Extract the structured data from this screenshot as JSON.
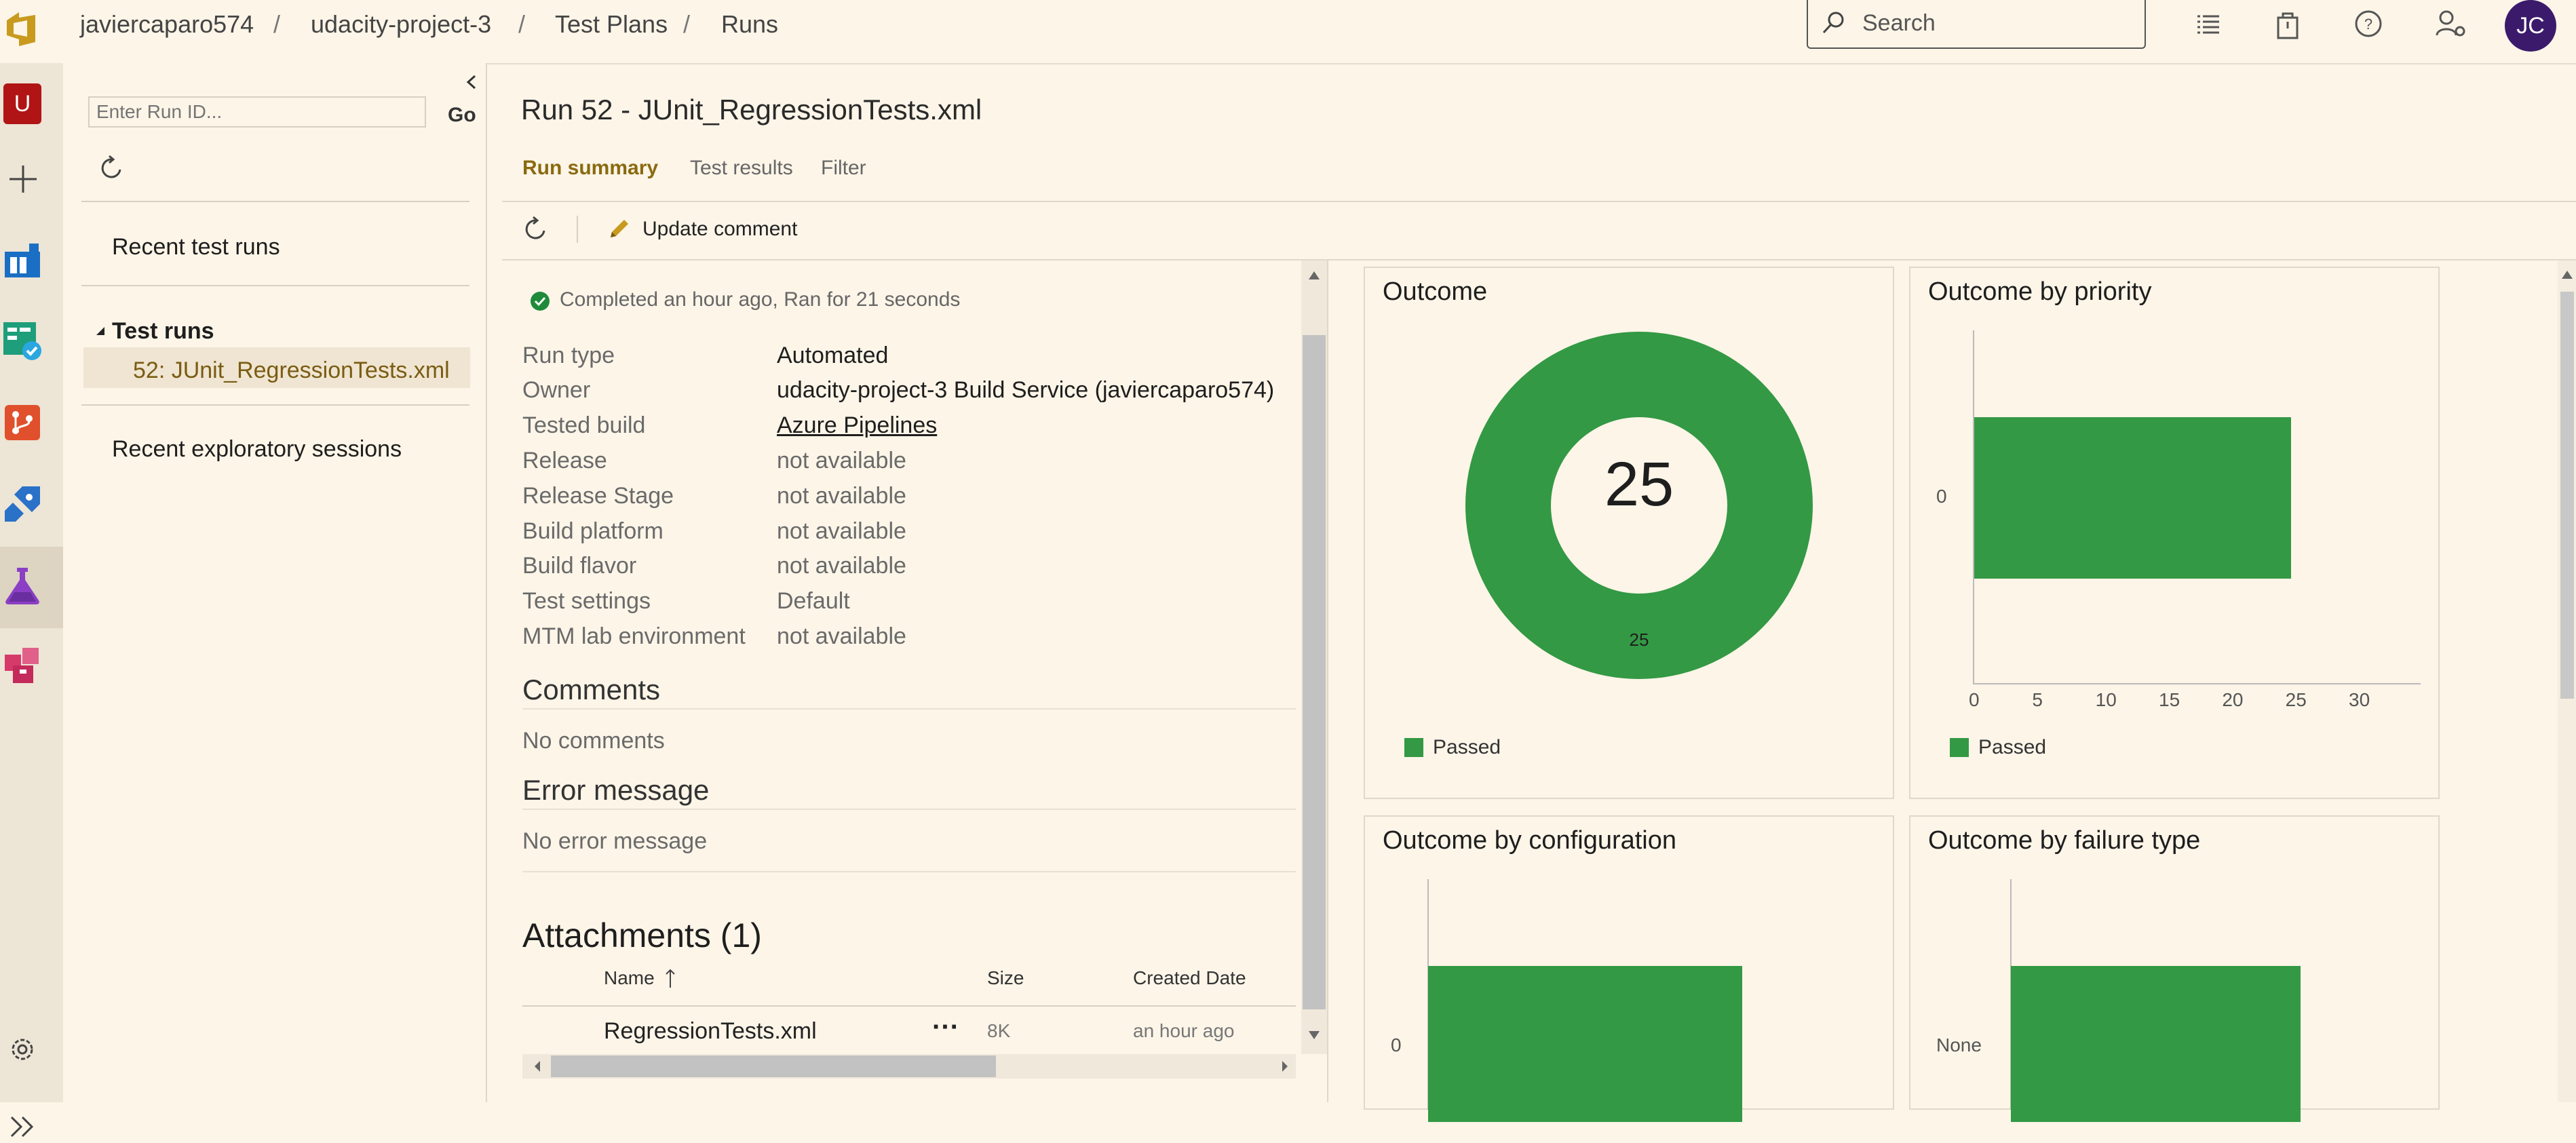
{
  "breadcrumbs": [
    "javiercaparo574",
    "udacity-project-3",
    "Test Plans",
    "Runs"
  ],
  "search": {
    "placeholder": "Search"
  },
  "user": {
    "initials": "JC"
  },
  "rail": {
    "org_initial": "U"
  },
  "left_panel": {
    "run_id_placeholder": "Enter Run ID...",
    "go_label": "Go",
    "recent_test_runs": "Recent test runs",
    "test_runs_header": "Test runs",
    "selected_run": "52: JUnit_RegressionTests.xml",
    "recent_exploratory": "Recent exploratory sessions"
  },
  "main": {
    "title": "Run 52 - JUnit_RegressionTests.xml",
    "tabs": [
      "Run summary",
      "Test results",
      "Filter"
    ],
    "toolbar": {
      "update_comment": "Update comment"
    },
    "status_text": "Completed an hour ago, Ran for 21 seconds",
    "details": [
      {
        "key": "Run type",
        "value": "Automated"
      },
      {
        "key": "Owner",
        "value": "udacity-project-3 Build Service (javiercaparo574)"
      },
      {
        "key": "Tested build",
        "value": "Azure Pipelines"
      },
      {
        "key": "Release",
        "value": "not available"
      },
      {
        "key": "Release Stage",
        "value": "not available"
      },
      {
        "key": "Build platform",
        "value": "not available"
      },
      {
        "key": "Build flavor",
        "value": "not available"
      },
      {
        "key": "Test settings",
        "value": "Default"
      },
      {
        "key": "MTM lab environment",
        "value": "not available"
      }
    ],
    "comments_header": "Comments",
    "comments_text": "No comments",
    "error_header": "Error message",
    "error_text": "No error message",
    "attachments_header": "Attachments (1)",
    "attachments_columns": [
      "Name",
      "Size",
      "Created Date"
    ],
    "attachments_rows": [
      {
        "name": "RegressionTests.xml",
        "size": "8K",
        "created": "an hour ago"
      }
    ]
  },
  "chart_data": [
    {
      "type": "pie",
      "title": "Outcome",
      "categories": [
        "Passed"
      ],
      "values": [
        25
      ],
      "center_label": "25",
      "legend": "bottom-left",
      "colors": [
        "#339944"
      ]
    },
    {
      "type": "bar",
      "title": "Outcome by priority",
      "categories": [
        "0"
      ],
      "series": [
        {
          "name": "Passed",
          "values": [
            25
          ]
        }
      ],
      "xlim": [
        0,
        30
      ],
      "xticks": [
        "0",
        "5",
        "10",
        "15",
        "20",
        "25",
        "30"
      ],
      "legend": "bottom-left",
      "colors": [
        "#339944"
      ]
    },
    {
      "type": "bar",
      "title": "Outcome by configuration",
      "categories": [
        "0"
      ],
      "series": [
        {
          "values": [
            25
          ]
        }
      ],
      "colors": [
        "#339944"
      ]
    },
    {
      "type": "bar",
      "title": "Outcome by failure type",
      "categories": [
        "None"
      ],
      "series": [
        {
          "values": [
            25
          ]
        }
      ],
      "colors": [
        "#339944"
      ]
    }
  ]
}
